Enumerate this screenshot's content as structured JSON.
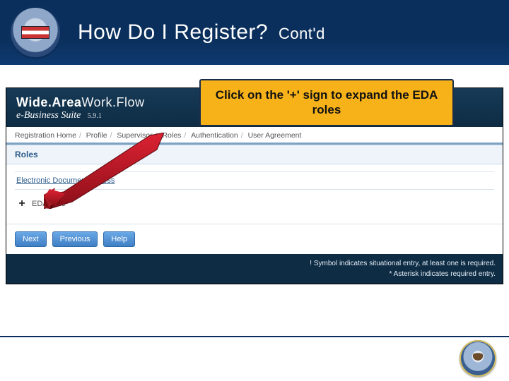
{
  "slide": {
    "title_main": "How Do I Register?",
    "title_suffix": "Cont'd"
  },
  "callout": {
    "text": "Click on the '+' sign to expand the EDA roles"
  },
  "app": {
    "brand": {
      "line1_bold": "Wide.Area",
      "line1_thin": "Work.Flow",
      "line2": "e-Business Suite",
      "version": "5.9.1"
    },
    "tabs": [
      "Registration Home",
      "Profile",
      "Supervisor",
      "Roles",
      "Authentication",
      "User Agreement"
    ],
    "panel_title": "Roles",
    "link_label": "Electronic Document Access",
    "expander": {
      "symbol": "+",
      "label": "EDA Role"
    },
    "buttons": {
      "next": "Next",
      "previous": "Previous",
      "help": "Help"
    },
    "footer": {
      "line1": "! Symbol indicates situational entry, at least one is required.",
      "line2": "* Asterisk indicates required entry."
    }
  }
}
